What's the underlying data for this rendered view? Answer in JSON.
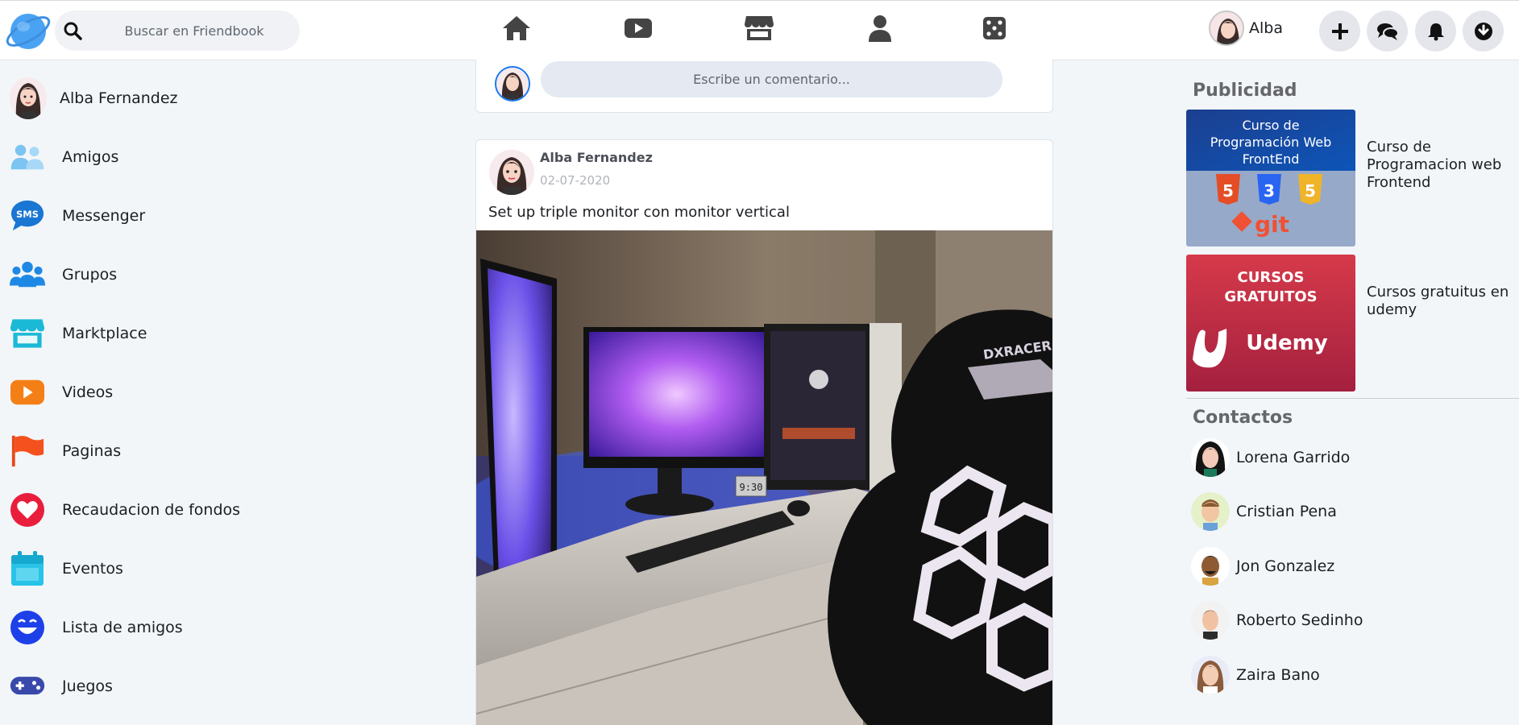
{
  "header": {
    "search_placeholder": "Buscar en Friendbook",
    "nav_icons": [
      "home-icon",
      "video-icon",
      "marketplace-icon",
      "profile-icon",
      "games-icon"
    ],
    "user_name": "Alba",
    "actions": [
      "plus-icon",
      "messenger-icon",
      "bell-icon",
      "download-icon"
    ]
  },
  "sidebar": {
    "profile_name": "Alba Fernandez",
    "items": [
      {
        "label": "Amigos",
        "icon": "friends-icon",
        "color": "#5ab3ec"
      },
      {
        "label": "Messenger",
        "icon": "sms-icon",
        "color": "#1976d2"
      },
      {
        "label": "Grupos",
        "icon": "groups-icon",
        "color": "#1e88e5"
      },
      {
        "label": "Marktplace",
        "icon": "store-icon",
        "color": "#1ab9d6"
      },
      {
        "label": "Videos",
        "icon": "play-icon",
        "color": "#f57f17"
      },
      {
        "label": "Paginas",
        "icon": "flag-icon",
        "color": "#f4511e"
      },
      {
        "label": "Recaudacion de fondos",
        "icon": "heart-icon",
        "color": "#e91e3c"
      },
      {
        "label": "Eventos",
        "icon": "calendar-icon",
        "color": "#29c3e8"
      },
      {
        "label": "Lista de amigos",
        "icon": "smile-icon",
        "color": "#1e40e8"
      },
      {
        "label": "Juegos",
        "icon": "gamepad-icon",
        "color": "#3949ab"
      }
    ]
  },
  "feed": {
    "comment_placeholder": "Escribe un comentario...",
    "post": {
      "author": "Alba Fernandez",
      "date": "02-07-2020",
      "text": "Set up triple monitor con monitor vertical",
      "image_alt": "Gaming desk setup with three monitors and a gaming chair",
      "chair_brand": "DXRACER",
      "clock": "9:30"
    }
  },
  "right": {
    "ads_title": "Publicidad",
    "ads": [
      {
        "image_line1": "Curso de",
        "image_line2": "Programación Web",
        "image_line3": "FrontEnd",
        "image_git": "git",
        "text": "Curso de Programacion web Frontend"
      },
      {
        "image_line1": "CURSOS",
        "image_line2": "GRATUITOS",
        "image_brand": "Udemy",
        "text": "Cursos gratuitus en udemy"
      }
    ],
    "contacts_title": "Contactos",
    "contacts": [
      "Lorena Garrido",
      "Cristian Pena",
      "Jon Gonzalez",
      "Roberto Sedinho",
      "Zaira Bano"
    ]
  }
}
